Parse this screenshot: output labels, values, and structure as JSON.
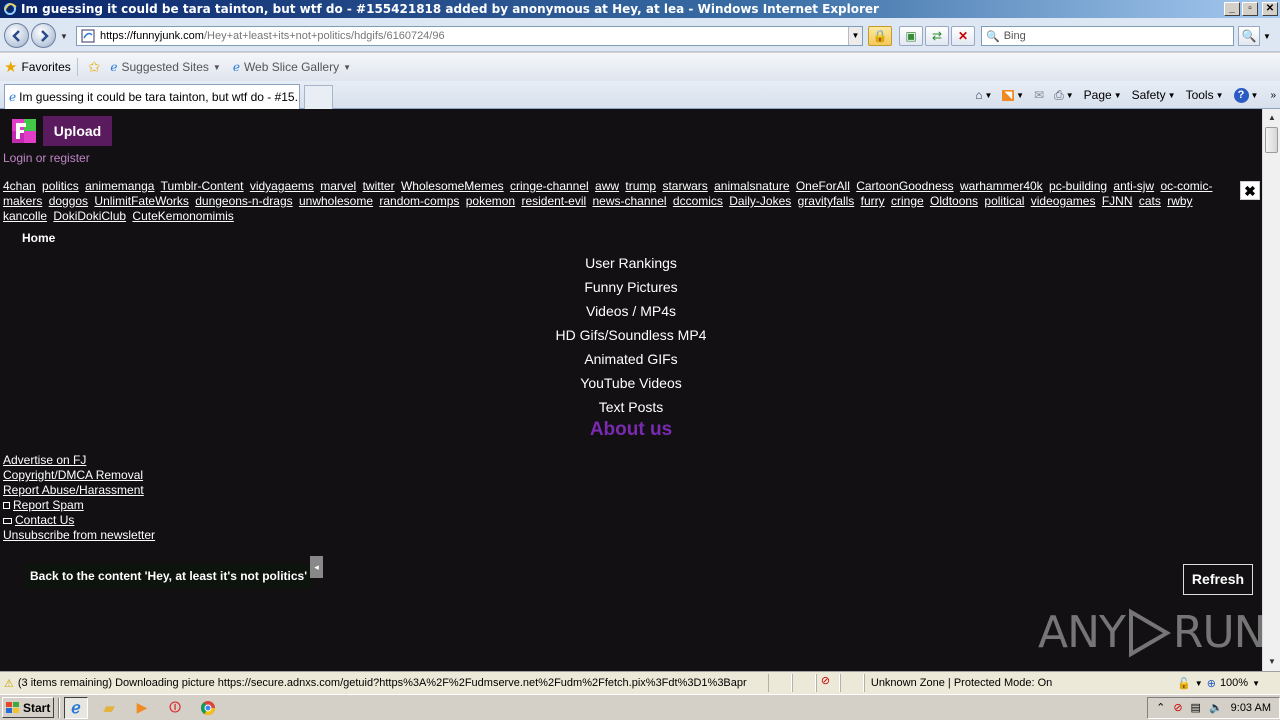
{
  "window": {
    "title": "Im guessing it could be tara tainton, but wtf do - #155421818 added by anonymous at Hey, at lea - Windows Internet Explorer",
    "btn_min": "_",
    "btn_max": "▫",
    "btn_close": "✕"
  },
  "address_bar": {
    "url_host": "https://funnyjunk.com",
    "url_path": "/Hey+at+least+its+not+politics/hdgifs/6160724/96",
    "search_placeholder": "Bing"
  },
  "favorites_bar": {
    "favorites_label": "Favorites",
    "suggested_sites": "Suggested Sites",
    "web_slice_gallery": "Web Slice Gallery"
  },
  "tabs": [
    {
      "label": "Im guessing it could be tara tainton, but wtf do - #15..."
    }
  ],
  "command_bar": {
    "page": "Page",
    "safety": "Safety",
    "tools": "Tools"
  },
  "page": {
    "upload_label": "Upload",
    "login_label": "Login or register",
    "tags": [
      "4chan",
      "politics",
      "animemanga",
      "Tumblr-Content",
      "vidyagaems",
      "marvel",
      "twitter",
      "WholesomeMemes",
      "cringe-channel",
      "aww",
      "trump",
      "starwars",
      "animalsnature",
      "OneForAll",
      "CartoonGoodness",
      "warhammer40k",
      "pc-building",
      "anti-sjw",
      "oc-comic-makers",
      "doggos",
      "UnlimitFateWorks",
      "dungeons-n-drags",
      "unwholesome",
      "random-comps",
      "pokemon",
      "resident-evil",
      "news-channel",
      "dccomics",
      "Daily-Jokes",
      "gravityfalls",
      "furry",
      "cringe",
      "Oldtoons",
      "political",
      "videogames",
      "FJNN",
      "cats",
      "rwby",
      "kancolle",
      "DokiDokiClub",
      "CuteKemonomimis"
    ],
    "close_label": "✖",
    "home_label": "Home",
    "center_nav": [
      "User Rankings",
      "Funny Pictures",
      "Videos / MP4s",
      "HD Gifs/Soundless MP4",
      "Animated GIFs",
      "YouTube Videos",
      "Text Posts"
    ],
    "about_label": "About us",
    "footer_links": {
      "advertise": "Advertise on FJ",
      "copyright": "Copyright/DMCA Removal",
      "report_abuse": "Report Abuse/Harassment",
      "report_spam": "Report Spam",
      "contact": "Contact Us",
      "unsubscribe": "Unsubscribe from newsletter"
    },
    "back_label": "Back to the content 'Hey, at least it's not politics'",
    "refresh_label": "Refresh",
    "watermark_left": "ANY",
    "watermark_right": "RUN"
  },
  "status_bar": {
    "text": "(3 items remaining) Downloading picture https://secure.adnxs.com/getuid?https%3A%2F%2Fudmserve.net%2Fudm%2Ffetch.pix%3Fdt%3D1%3Bapr",
    "zone": "Unknown Zone | Protected Mode: On",
    "zoom": "100%"
  },
  "taskbar": {
    "start_label": "Start",
    "clock": "9:03 AM"
  },
  "colors": {
    "page_bg": "#121013",
    "upload_bg": "#5a1a5e",
    "login_link": "#c084c8",
    "about_purple": "#7a2ab0"
  }
}
